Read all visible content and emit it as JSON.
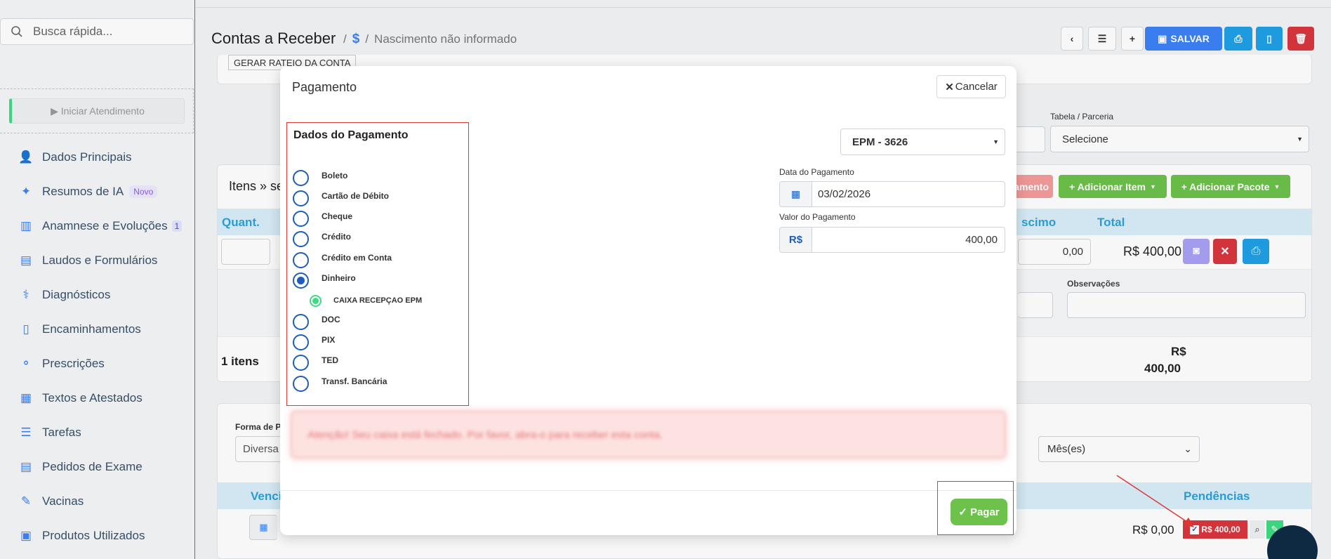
{
  "search": {
    "placeholder": "Busca rápida..."
  },
  "sidebar": {
    "start_label": "▶ Iniciar Atendimento",
    "items": [
      {
        "label": "Dados Principais",
        "icon": "user-icon"
      },
      {
        "label": "Resumos de IA",
        "icon": "sparkles-icon",
        "badge": "Novo"
      },
      {
        "label": "Anamnese e Evoluções",
        "icon": "chart-icon",
        "badge": "1"
      },
      {
        "label": "Laudos e Formulários",
        "icon": "clipboard-icon"
      },
      {
        "label": "Diagnósticos",
        "icon": "stethoscope-icon"
      },
      {
        "label": "Encaminhamentos",
        "icon": "document-icon"
      },
      {
        "label": "Prescrições",
        "icon": "pills-icon"
      },
      {
        "label": "Textos e Atestados",
        "icon": "file-text-icon"
      },
      {
        "label": "Tarefas",
        "icon": "list-icon"
      },
      {
        "label": "Pedidos de Exame",
        "icon": "clipboard-list-icon"
      },
      {
        "label": "Vacinas",
        "icon": "syringe-icon"
      },
      {
        "label": "Produtos Utilizados",
        "icon": "box-icon"
      }
    ]
  },
  "header": {
    "title": "Contas a Receber",
    "sep1": "/",
    "dollar": "$",
    "sep2": "/",
    "crumb": "Nascimento não informado",
    "save_label": "SALVAR"
  },
  "background": {
    "gerar_rateio": "GERAR RATEIO DA CONTA",
    "tabela_label": "Tabela / Parceria",
    "tabela_value": "Selecione",
    "itens_title": "Itens » se",
    "pagamento_btn": "amento",
    "add_item": "+ Adicionar Item",
    "add_pacote": "+ Adicionar Pacote",
    "col_quant": "Quant.",
    "col_acrescimo": "scimo",
    "col_total": "Total",
    "acrescimo_value": "0,00",
    "total_value": "R$ 400,00",
    "observacoes_label": "Observações",
    "itens_count": "1 itens",
    "sum_currency": "R$",
    "sum_value": "400,00",
    "forma_label": "Forma de P",
    "forma_value": "Diversa",
    "meses_value": "Mês(es)",
    "col_venc": "Venci",
    "col_pendencias": "Pendências",
    "row_value": "R$ 0,00",
    "pend_badge": "R$ 400,00"
  },
  "modal": {
    "title": "Pagamento",
    "cancel_label": "Cancelar",
    "section_title": "Dados do Pagamento",
    "options": [
      "Boleto",
      "Cartão de Débito",
      "Cheque",
      "Crédito",
      "Crédito em Conta",
      "Dinheiro"
    ],
    "selected_option": "Dinheiro",
    "sub_option": "CAIXA RECEPÇAO EPM",
    "options_after": [
      "DOC",
      "PIX",
      "TED",
      "Transf. Bancária"
    ],
    "account_select": "EPM - 3626",
    "date_label": "Data do Pagamento",
    "date_value": "03/02/2026",
    "value_label": "Valor do Pagamento",
    "currency_prefix": "R$",
    "value_value": "400,00",
    "alert_text": "Atenção! Seu caixa está fechado. Por favor, abra-o para receber esta conta.",
    "pay_label": "Pagar"
  },
  "colors": {
    "primary": "#3b82f6",
    "success": "#6cc24a",
    "danger": "#d9363e",
    "info": "#1ea1e6",
    "highlight": "#e53935"
  }
}
